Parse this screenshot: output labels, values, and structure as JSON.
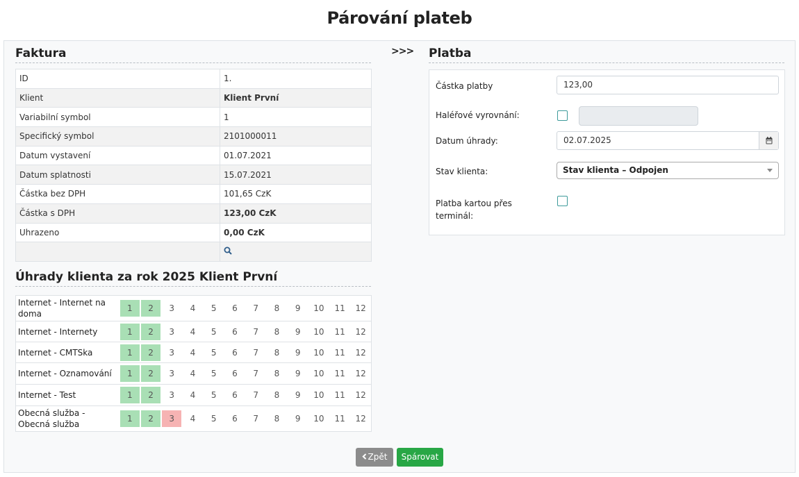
{
  "page": {
    "title": "Párování plateb"
  },
  "faktura": {
    "title": "Faktura",
    "rows": [
      {
        "label": "ID",
        "value": "1."
      },
      {
        "label": "Klient",
        "value": "Klient První"
      },
      {
        "label": "Variabilní symbol",
        "value": "1"
      },
      {
        "label": "Specifický symbol",
        "value": "2101000011"
      },
      {
        "label": "Datum vystavení",
        "value": "01.07.2021"
      },
      {
        "label": "Datum splatnosti",
        "value": "15.07.2021"
      },
      {
        "label": "Částka bez DPH",
        "value": "101,65 CzK"
      },
      {
        "label": "Částka s DPH",
        "value": "123,00 CzK"
      },
      {
        "label": "Uhrazeno",
        "value": "0,00 CzK"
      }
    ]
  },
  "arrows": ">>>",
  "platba": {
    "title": "Platba",
    "amount_label": "Částka platby",
    "amount_value": "123,00",
    "rounding_label": "Haléřové vyrovnání:",
    "date_label": "Datum úhrady:",
    "date_value": "02.07.2025",
    "client_state_label": "Stav klienta:",
    "client_state_value": "Stav klienta – Odpojen",
    "card_label_line1": "Platba kartou přes",
    "card_label_line2": "terminál:"
  },
  "payments": {
    "title": "Úhrady klienta za rok 2025 Klient První",
    "months": [
      "1",
      "2",
      "3",
      "4",
      "5",
      "6",
      "7",
      "8",
      "9",
      "10",
      "11",
      "12"
    ],
    "services": [
      {
        "name": "Internet - Internet na doma",
        "status": [
          "paid",
          "paid",
          "none",
          "none",
          "none",
          "none",
          "none",
          "none",
          "none",
          "none",
          "none",
          "none"
        ]
      },
      {
        "name": "Internet - Internety",
        "status": [
          "paid",
          "paid",
          "none",
          "none",
          "none",
          "none",
          "none",
          "none",
          "none",
          "none",
          "none",
          "none"
        ]
      },
      {
        "name": "Internet - CMTSka",
        "status": [
          "paid",
          "paid",
          "none",
          "none",
          "none",
          "none",
          "none",
          "none",
          "none",
          "none",
          "none",
          "none"
        ]
      },
      {
        "name": "Internet - Oznamování",
        "status": [
          "paid",
          "paid",
          "none",
          "none",
          "none",
          "none",
          "none",
          "none",
          "none",
          "none",
          "none",
          "none"
        ]
      },
      {
        "name": "Internet - Test",
        "status": [
          "paid",
          "paid",
          "none",
          "none",
          "none",
          "none",
          "none",
          "none",
          "none",
          "none",
          "none",
          "none"
        ]
      },
      {
        "name": "Obecná služba - Obecná služba",
        "status": [
          "paid",
          "paid",
          "unpaid",
          "none",
          "none",
          "none",
          "none",
          "none",
          "none",
          "none",
          "none",
          "none"
        ]
      }
    ]
  },
  "buttons": {
    "back_label": "Zpět",
    "pair_label": "Spárovat"
  },
  "colors": {
    "paid": "#a9dfb5",
    "unpaid": "#f6b3b3",
    "accent_red": "#8b1a2b",
    "success": "#28a745"
  },
  "icons": {
    "search": "search-icon",
    "calendar": "calendar-icon",
    "back": "chevron-left-icon"
  }
}
